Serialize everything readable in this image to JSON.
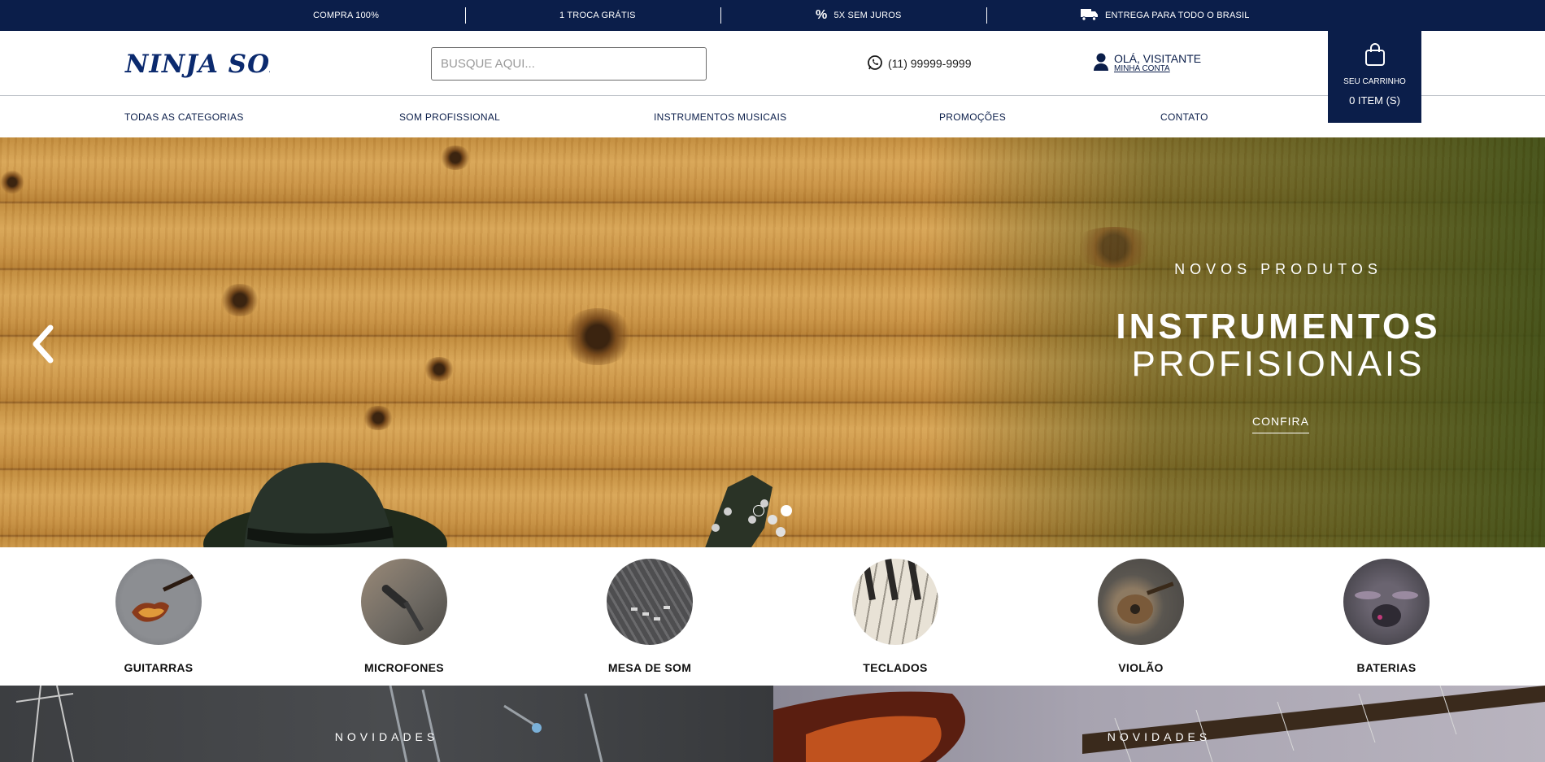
{
  "topbar": {
    "items": [
      {
        "label": "COMPRA 100%",
        "icon": "lock-icon"
      },
      {
        "label": "1 TROCA GRÁTIS",
        "icon": "exchange-icon"
      },
      {
        "label": "5X SEM JUROS",
        "icon": "percent-icon"
      },
      {
        "label": "ENTREGA PARA TODO O BRASIL",
        "icon": "truck-icon"
      }
    ]
  },
  "header": {
    "logo_text": "NINJA SOM",
    "search": {
      "placeholder": "BUSQUE AQUI...",
      "value": ""
    },
    "phone": "(11) 99999-9999",
    "account": {
      "greeting": "OLÁ, VISITANTE",
      "link": "MINHA CONTA"
    },
    "cart": {
      "label": "SEU CARRINHO",
      "count": "0 ITEM (S)"
    }
  },
  "nav": {
    "items": [
      {
        "label": "TODAS AS CATEGORIAS"
      },
      {
        "label": "SOM PROFISSIONAL"
      },
      {
        "label": "INSTRUMENTOS MUSICAIS"
      },
      {
        "label": "PROMOÇÕES"
      },
      {
        "label": "CONTATO"
      }
    ]
  },
  "hero": {
    "kicker": "NOVOS PRODUTOS",
    "title_line1": "INSTRUMENTOS",
    "title_line2": "PROFISIONAIS",
    "cta": "CONFIRA",
    "active_slide": 2,
    "total_slides": 2
  },
  "categories": [
    {
      "name": "GUITARRAS"
    },
    {
      "name": "MICROFONES"
    },
    {
      "name": "MESA DE SOM"
    },
    {
      "name": "TECLADOS"
    },
    {
      "name": "VIOLÃO"
    },
    {
      "name": "BATERIAS"
    }
  ],
  "promos": [
    {
      "label": "NOVIDADES"
    },
    {
      "label": "NOVIDADES"
    }
  ],
  "colors": {
    "brand_navy": "#0b1e4a",
    "hero_wood": "#c7903f",
    "hero_overlay": "#344812"
  }
}
